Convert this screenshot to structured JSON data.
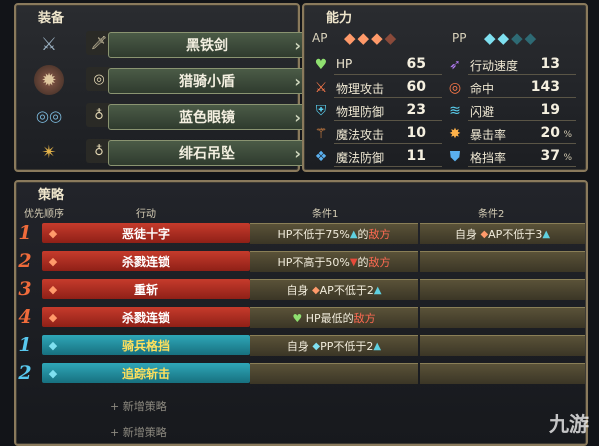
{
  "equipment": {
    "title": "装备",
    "items": [
      {
        "icon": "sword-icon",
        "slot_icon": "sword-slot-icon",
        "name": "黑铁剑"
      },
      {
        "icon": "shield-icon",
        "slot_icon": "shield-slot-icon",
        "name": "猎骑小盾"
      },
      {
        "icon": "glasses-icon",
        "slot_icon": "ring-slot-icon",
        "name": "蓝色眼镜"
      },
      {
        "icon": "pendant-icon",
        "slot_icon": "ring-slot-icon",
        "name": "绯石吊坠"
      }
    ]
  },
  "ability": {
    "title": "能力",
    "ap_label": "AP",
    "pp_label": "PP",
    "ap_gems": 4,
    "pp_gems": 4,
    "stats_left": [
      {
        "icon": "heart-icon",
        "label": "HP",
        "value": "65"
      },
      {
        "icon": "sword-stat-icon",
        "label": "物理攻击",
        "value": "60"
      },
      {
        "icon": "armor-icon",
        "label": "物理防御",
        "value": "23"
      },
      {
        "icon": "staff-icon",
        "label": "魔法攻击",
        "value": "10"
      },
      {
        "icon": "magic-defense-icon",
        "label": "魔法防御",
        "value": "11"
      }
    ],
    "stats_right": [
      {
        "icon": "speed-icon",
        "label": "行动速度",
        "value": "13",
        "unit": ""
      },
      {
        "icon": "target-icon",
        "label": "命中",
        "value": "143",
        "unit": ""
      },
      {
        "icon": "evade-icon",
        "label": "闪避",
        "value": "19",
        "unit": ""
      },
      {
        "icon": "critical-icon",
        "label": "暴击率",
        "value": "20",
        "unit": "%"
      },
      {
        "icon": "block-icon",
        "label": "格挡率",
        "value": "37",
        "unit": "%"
      }
    ]
  },
  "strategy": {
    "title": "策略",
    "col_priority": "优先顺序",
    "col_action": "行动",
    "col_cond1": "条件1",
    "col_cond2": "条件2",
    "rows": [
      {
        "priority": "1",
        "type": "red",
        "action": "恶徒十字",
        "c1_a": "HP不低于75%",
        "c1_sym": "▲",
        "c1_b": "的",
        "c1_foe": "敌方",
        "c2_a": "自身",
        "c2_sym": "◆",
        "c2_b": "AP不低于3",
        "c2_sym2": "▲"
      },
      {
        "priority": "2",
        "type": "red",
        "action": "杀戮连锁",
        "c1_a": "HP不高于50%",
        "c1_sym": "▼",
        "c1_b": "的",
        "c1_foe": "敌方",
        "c2_a": "",
        "c2_sym": "",
        "c2_b": "",
        "c2_sym2": ""
      },
      {
        "priority": "3",
        "type": "red",
        "action": "重斩",
        "c1_a": "自身",
        "c1_sym": "◆",
        "c1_b": "AP不低于2",
        "c1_foe": "▲",
        "c2_a": "",
        "c2_sym": "",
        "c2_b": "",
        "c2_sym2": ""
      },
      {
        "priority": "4",
        "type": "red",
        "action": "杀戮连锁",
        "c1_a": "♥",
        "c1_sym": "",
        "c1_b": "HP最低的",
        "c1_foe": "敌方",
        "c2_a": "",
        "c2_sym": "",
        "c2_b": "",
        "c2_sym2": ""
      },
      {
        "priority": "1",
        "type": "blue",
        "action": "骑兵格挡",
        "c1_a": "自身",
        "c1_sym": "◆",
        "c1_b": "PP不低于2",
        "c1_foe": "▲",
        "c2_a": "",
        "c2_sym": "",
        "c2_b": "",
        "c2_sym2": ""
      },
      {
        "priority": "2",
        "type": "blue",
        "action": "追踪斩击",
        "c1_a": "",
        "c1_sym": "",
        "c1_b": "",
        "c1_foe": "",
        "c2_a": "",
        "c2_sym": "",
        "c2_b": "",
        "c2_sym2": ""
      }
    ],
    "add_label": "+ 新增策略"
  },
  "watermark": "九游"
}
